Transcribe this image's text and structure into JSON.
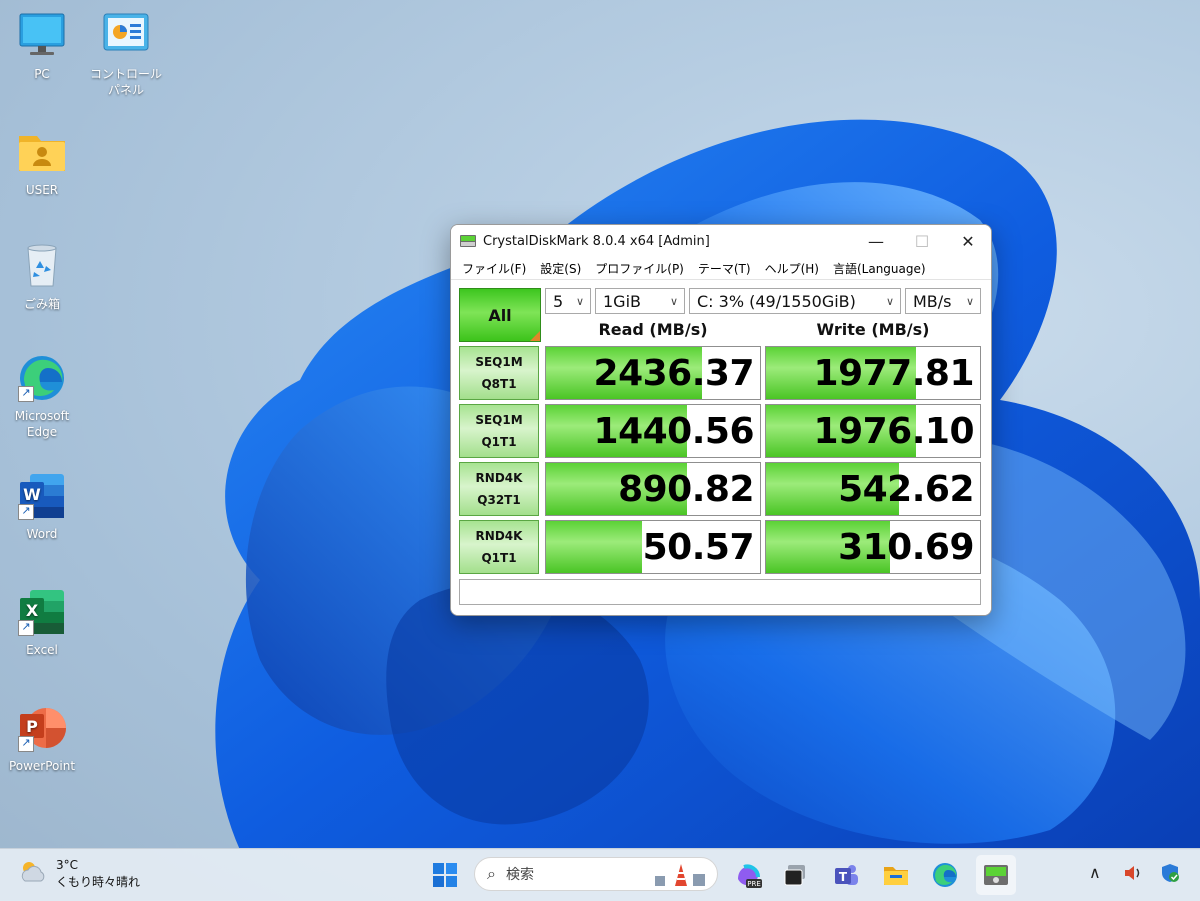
{
  "desktop": {
    "icons": [
      {
        "label": "PC"
      },
      {
        "label": "コントロール パネル"
      },
      {
        "label": "USER"
      },
      {
        "label": "ごみ箱"
      },
      {
        "label": "Microsoft Edge"
      },
      {
        "label": "Word"
      },
      {
        "label": "Excel"
      },
      {
        "label": "PowerPoint"
      }
    ]
  },
  "window": {
    "title": "CrystalDiskMark 8.0.4 x64 [Admin]",
    "controls": {
      "minimize": "—",
      "maximize": "☐",
      "close": "✕"
    },
    "menu": [
      "ファイル(F)",
      "設定(S)",
      "プロファイル(P)",
      "テーマ(T)",
      "ヘルプ(H)",
      "言語(Language)"
    ],
    "all_button": "All",
    "count": "5",
    "size": "1GiB",
    "drive": "C: 3% (49/1550GiB)",
    "unit": "MB/s",
    "read_header": "Read (MB/s)",
    "write_header": "Write (MB/s)",
    "accent": "#4ac525",
    "tests": [
      {
        "line1": "SEQ1M",
        "line2": "Q8T1",
        "read": "2436.37",
        "write": "1977.81",
        "read_level": 0.73,
        "write_level": 0.7
      },
      {
        "line1": "SEQ1M",
        "line2": "Q1T1",
        "read": "1440.56",
        "write": "1976.10",
        "read_level": 0.66,
        "write_level": 0.7
      },
      {
        "line1": "RND4K",
        "line2": "Q32T1",
        "read": "890.82",
        "write": "542.62",
        "read_level": 0.66,
        "write_level": 0.62
      },
      {
        "line1": "RND4K",
        "line2": "Q1T1",
        "read": "50.57",
        "write": "310.69",
        "read_level": 0.45,
        "write_level": 0.58
      }
    ],
    "comment": ""
  },
  "taskbar": {
    "weather_temp": "3°C",
    "weather_desc": "くもり時々晴れ",
    "search_placeholder": "検索",
    "icons": [
      "start-icon",
      "copilot-icon",
      "task-view-icon",
      "teams-icon",
      "file-explorer-icon",
      "edge-icon",
      "crystaldiskmark-icon"
    ],
    "tray": [
      "chevron-up-icon",
      "speaker-icon",
      "defender-icon"
    ]
  }
}
